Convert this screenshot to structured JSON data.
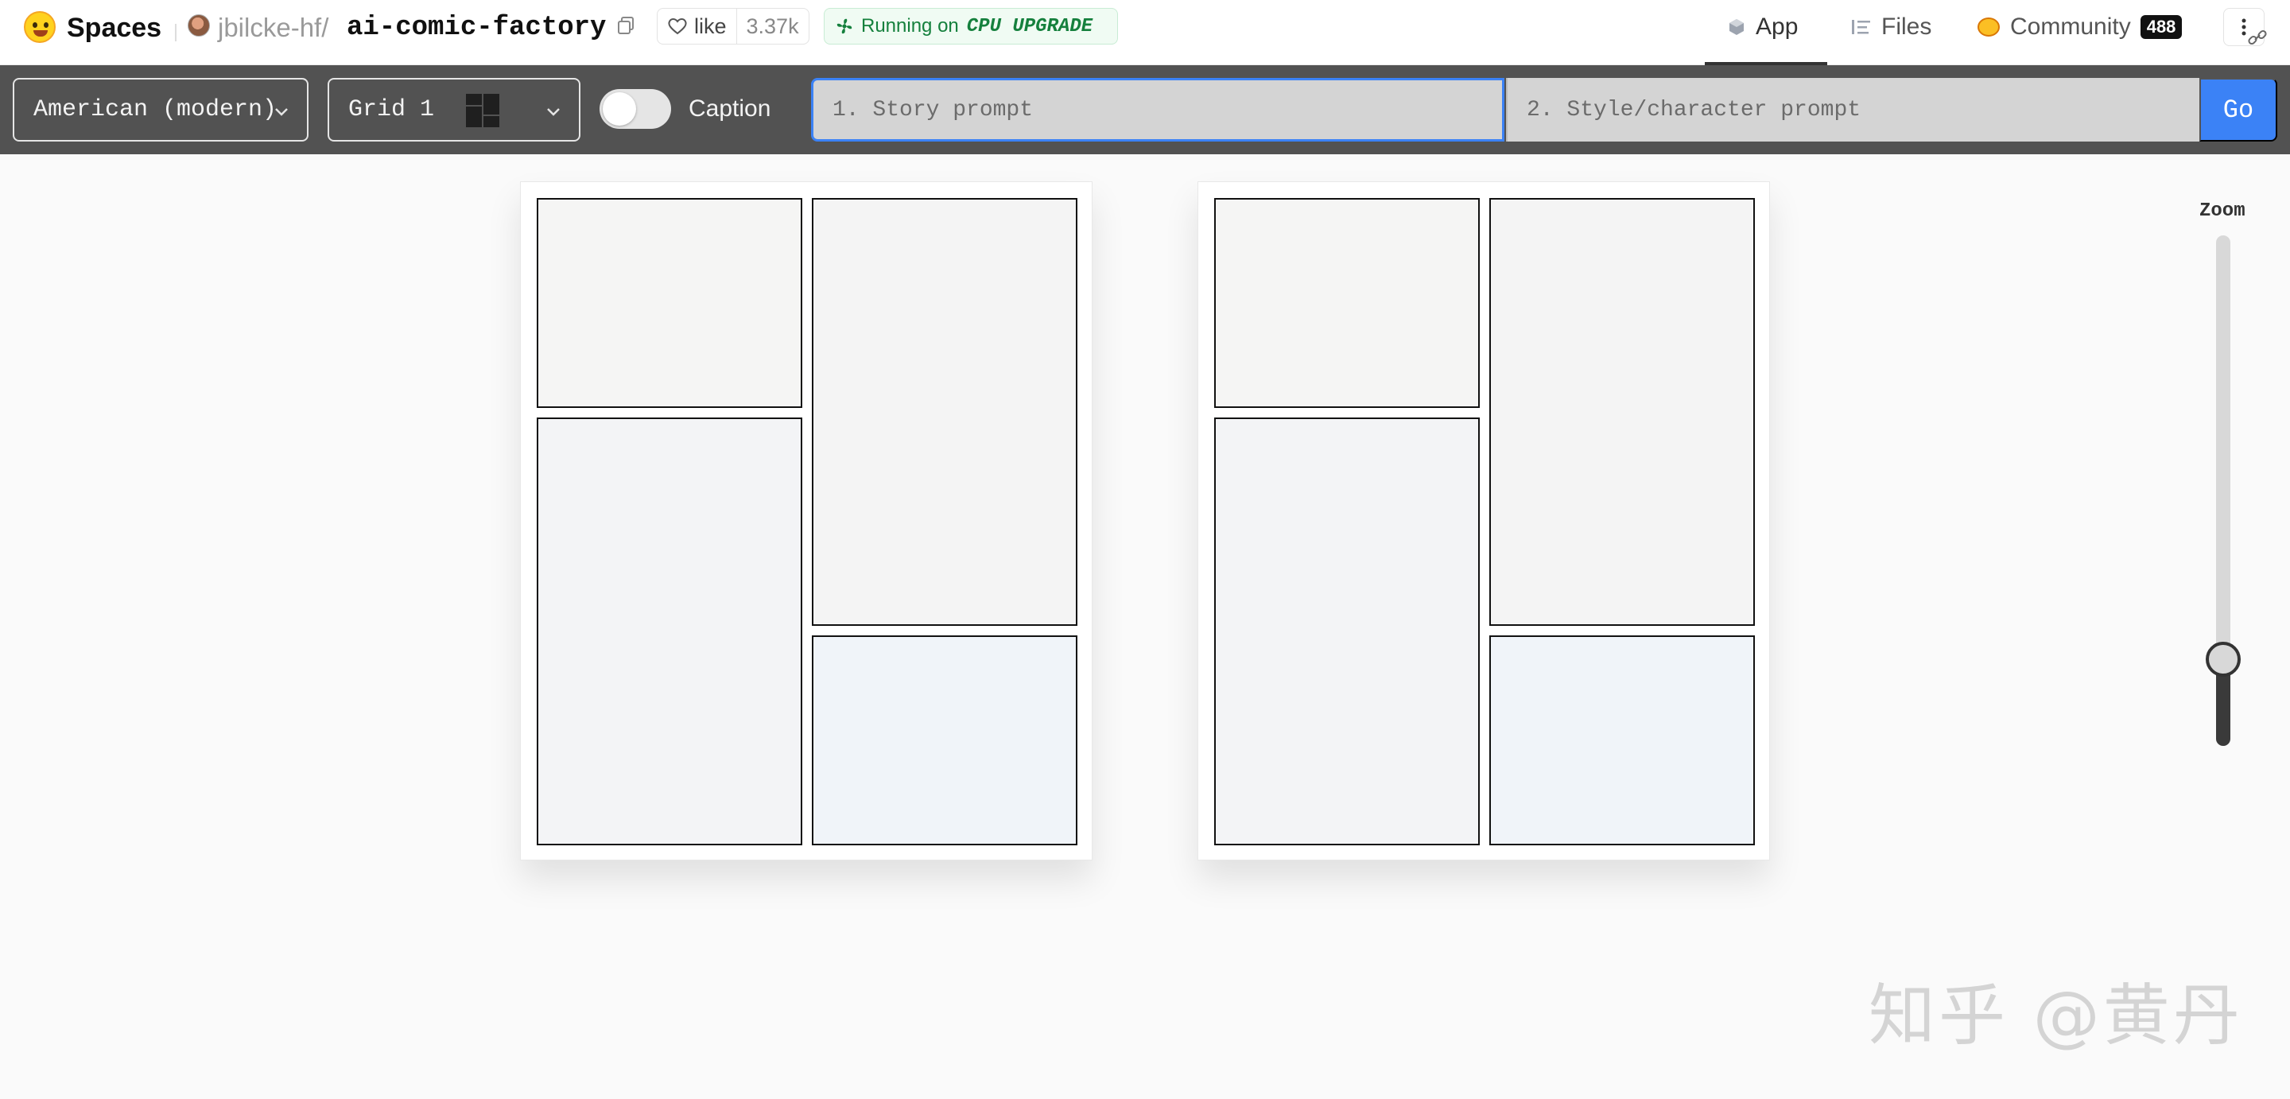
{
  "header": {
    "brand": "Spaces",
    "owner": "jbilcke-hf",
    "slash": "/",
    "repo": "ai-comic-factory",
    "like_label": "like",
    "like_count": "3.37k",
    "status_prefix": "Running on",
    "status_hardware": "CPU UPGRADE",
    "nav": {
      "app": "App",
      "files": "Files",
      "community": "Community",
      "community_count": "488"
    }
  },
  "toolbar": {
    "style_select": "American (modern)",
    "layout_select": "Grid 1",
    "caption_label": "Caption",
    "caption_on": false,
    "story_placeholder": "1. Story prompt",
    "style_placeholder": "2. Style/character prompt",
    "go_label": "Go"
  },
  "zoom": {
    "label": "Zoom",
    "level_fraction": 0.17
  },
  "watermark": "知乎 @黄丹",
  "colors": {
    "toolbar_bg": "#525252",
    "accent": "#3b82f6",
    "status_green": "#15803d",
    "panel_border": "#111111"
  }
}
